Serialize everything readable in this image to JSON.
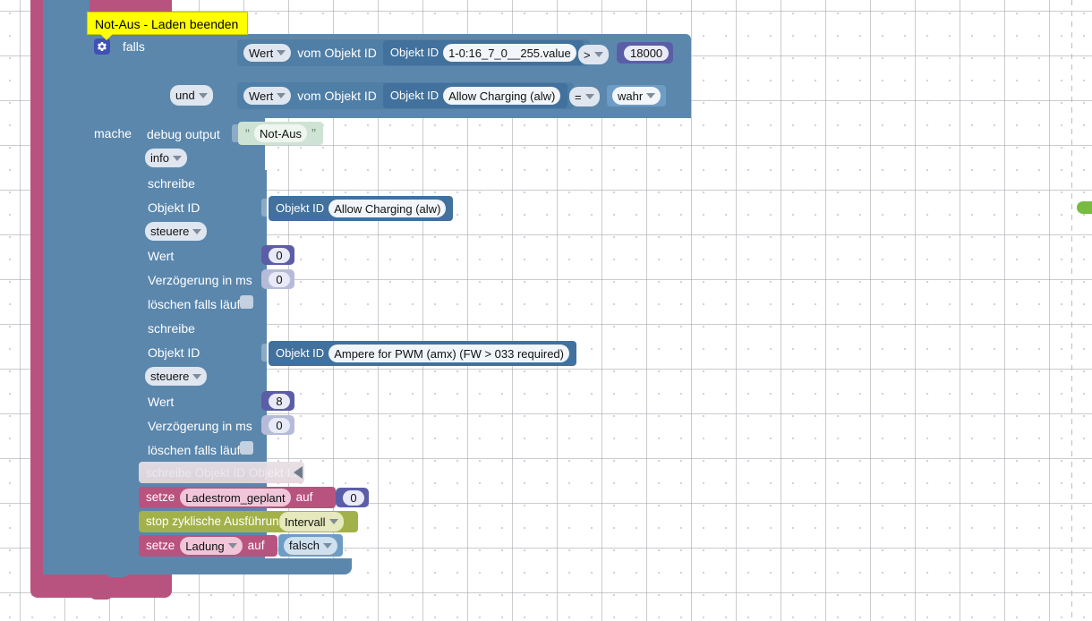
{
  "workspace": {
    "comment": {
      "text": "Not-Aus - Laden beenden"
    },
    "if_block": {
      "gear_icon": "gear-icon",
      "if_label": "falls",
      "and_label": "und",
      "do_label": "mache",
      "conditions": [
        {
          "selector": "Wert",
          "text_before": "vom Objekt ID",
          "objid_label": "Objekt ID",
          "objid_value": "1-0:16_7_0__255.value",
          "operator": ">",
          "value_block": {
            "kind": "number",
            "value": "18000"
          }
        },
        {
          "selector": "Wert",
          "text_before": "vom Objekt ID",
          "objid_label": "Objekt ID",
          "objid_value": "Allow Charging (alw)",
          "operator": "=",
          "value_block": {
            "kind": "logic",
            "value": "wahr"
          }
        }
      ]
    },
    "statements": [
      {
        "type": "debug-output",
        "label": "debug output",
        "level": "info",
        "message": "Not-Aus",
        "quote_open": "“",
        "quote_close": "”"
      },
      {
        "type": "control-write",
        "title": "schreibe",
        "objid_row_label": "Objekt ID",
        "objid_label": "Objekt ID",
        "objid_value": "Allow Charging (alw)",
        "mode": "steuere",
        "value_label": "Wert",
        "value": "0",
        "delay_label": "Verzögerung in ms",
        "delay": "0",
        "clear_label": "löschen falls läuft",
        "clear_checked": false
      },
      {
        "type": "control-write",
        "title": "schreibe",
        "objid_row_label": "Objekt ID",
        "objid_label": "Objekt ID",
        "objid_value": "Ampere for PWM (amx) (FW > 033 required)",
        "mode": "steuere",
        "value_label": "Wert",
        "value": "8",
        "delay_label": "Verzögerung in ms",
        "delay": "0",
        "clear_label": "löschen falls läuft",
        "clear_checked": false
      },
      {
        "type": "collapsed-disabled",
        "label": "schreibe Objekt ID Objekt I..."
      },
      {
        "type": "set-variable",
        "set_label": "setze",
        "variable": "Ladestrom_geplant",
        "to_label": "auf",
        "value": "0"
      },
      {
        "type": "stop-interval",
        "label": "stop zyklische Ausführung",
        "interval": "Intervall"
      },
      {
        "type": "set-variable-logic",
        "set_label": "setze",
        "variable": "Ladung",
        "to_label": "auf",
        "value": "falsch"
      }
    ]
  },
  "colors": {
    "control_blue": "#5b87ad",
    "magenta": "#b8537f",
    "olive": "#a3b14a",
    "logic_blue": "#6d9dc5",
    "math_purple": "#5b5ea6",
    "text_green": "#cfe3d4",
    "comment_yellow": "#ffff00",
    "green_edge": "#77bb41"
  }
}
